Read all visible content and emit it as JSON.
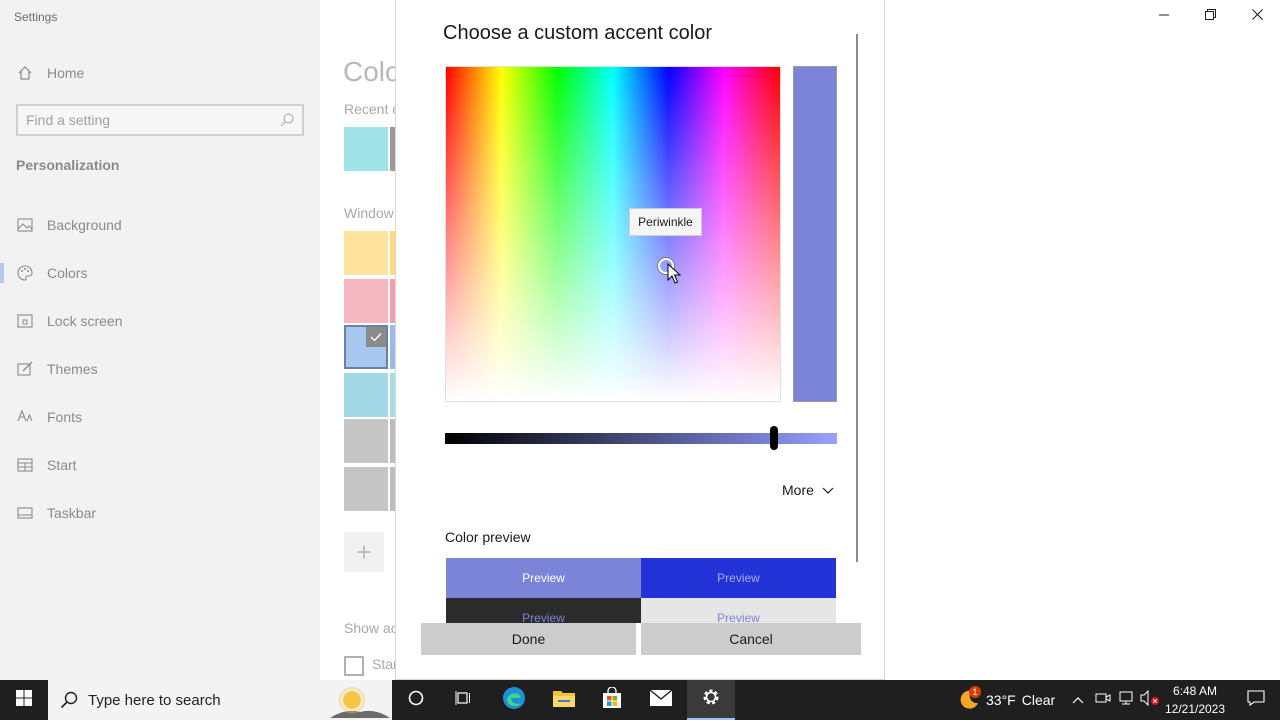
{
  "window": {
    "app_title": "Settings"
  },
  "sidebar": {
    "home_label": "Home",
    "search_placeholder": "Find a setting",
    "section_title": "Personalization",
    "items": [
      {
        "label": "Background",
        "icon": "image-icon"
      },
      {
        "label": "Colors",
        "icon": "palette-icon"
      },
      {
        "label": "Lock screen",
        "icon": "lock-screen-icon"
      },
      {
        "label": "Themes",
        "icon": "brush-icon"
      },
      {
        "label": "Fonts",
        "icon": "font-icon"
      },
      {
        "label": "Start",
        "icon": "start-icon"
      },
      {
        "label": "Taskbar",
        "icon": "taskbar-icon"
      }
    ],
    "active_item": "Colors"
  },
  "main": {
    "page_title": "Colo",
    "recent_label": "Recent c",
    "windows_label": "Window",
    "show_accent_label": "Show ac",
    "start_label": "Star",
    "recent_colors": [
      "#9fe3e6",
      "#9a9a9a"
    ],
    "window_colors": [
      "#ffe4a0",
      "#f6b8c0",
      "#a6c8ef",
      "#a4d8e6",
      "#c6c6c6",
      "#c6c6c6"
    ]
  },
  "dialog": {
    "title": "Choose a custom accent color",
    "tooltip": "Periwinkle",
    "selected_color": "#7b84d8",
    "value_level": 0.84,
    "more_label": "More",
    "preview_label": "Color preview",
    "previews": [
      "Preview",
      "Preview",
      "Preview",
      "Preview"
    ],
    "preview_colors": {
      "accent_light": "#7b84d8",
      "accent_dark": "#2433d8",
      "dark_bg": "#2b2b2b",
      "light_bg": "#e6e6e6"
    },
    "done_label": "Done",
    "cancel_label": "Cancel"
  },
  "taskbar": {
    "search_placeholder": "Type here to search",
    "weather_temp": "33°F",
    "weather_desc": "Clear",
    "weather_badge": "1",
    "time": "6:48 AM",
    "date": "12/21/2023"
  }
}
